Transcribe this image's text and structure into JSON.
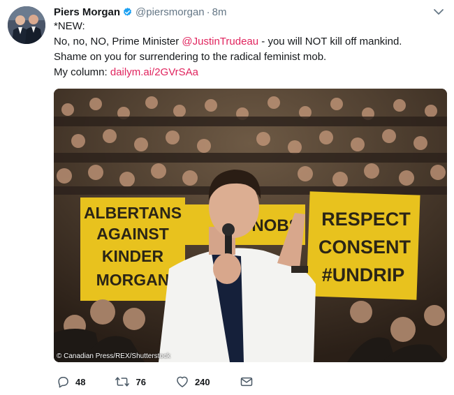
{
  "tweet": {
    "display_name": "Piers Morgan",
    "handle": "@piersmorgan",
    "separator": "·",
    "time": "8m",
    "text": {
      "line1": "*NEW:",
      "line2_a": "No, no, NO, Prime Minister ",
      "line2_mention": "@JustinTrudeau",
      "line2_b": " - you will NOT kill off mankind.",
      "line3": "Shame on you for surrendering to the radical feminist mob.",
      "line4_a": "My column: ",
      "line4_link": "dailym.ai/2GVrSAa"
    },
    "image": {
      "credit": "© Canadian Press/REX/Shutterstock",
      "signs": {
        "left": [
          "ALBERTANS",
          "AGAINST",
          "KINDER",
          "MORGAN"
        ],
        "middle": "NOBS",
        "right": [
          "RESPECT",
          "CONSENT",
          "#UNDRIP"
        ]
      }
    },
    "actions": {
      "reply_count": "48",
      "retweet_count": "76",
      "like_count": "240"
    }
  },
  "icons": {
    "verified": "verified-badge-icon",
    "caret": "chevron-down-icon",
    "reply": "reply-icon",
    "retweet": "retweet-icon",
    "like": "heart-icon",
    "dm": "envelope-icon"
  },
  "colors": {
    "link": "#e0245e",
    "verified": "#1da1f2",
    "muted": "#657786",
    "sign_yellow": "#e8c21e"
  }
}
